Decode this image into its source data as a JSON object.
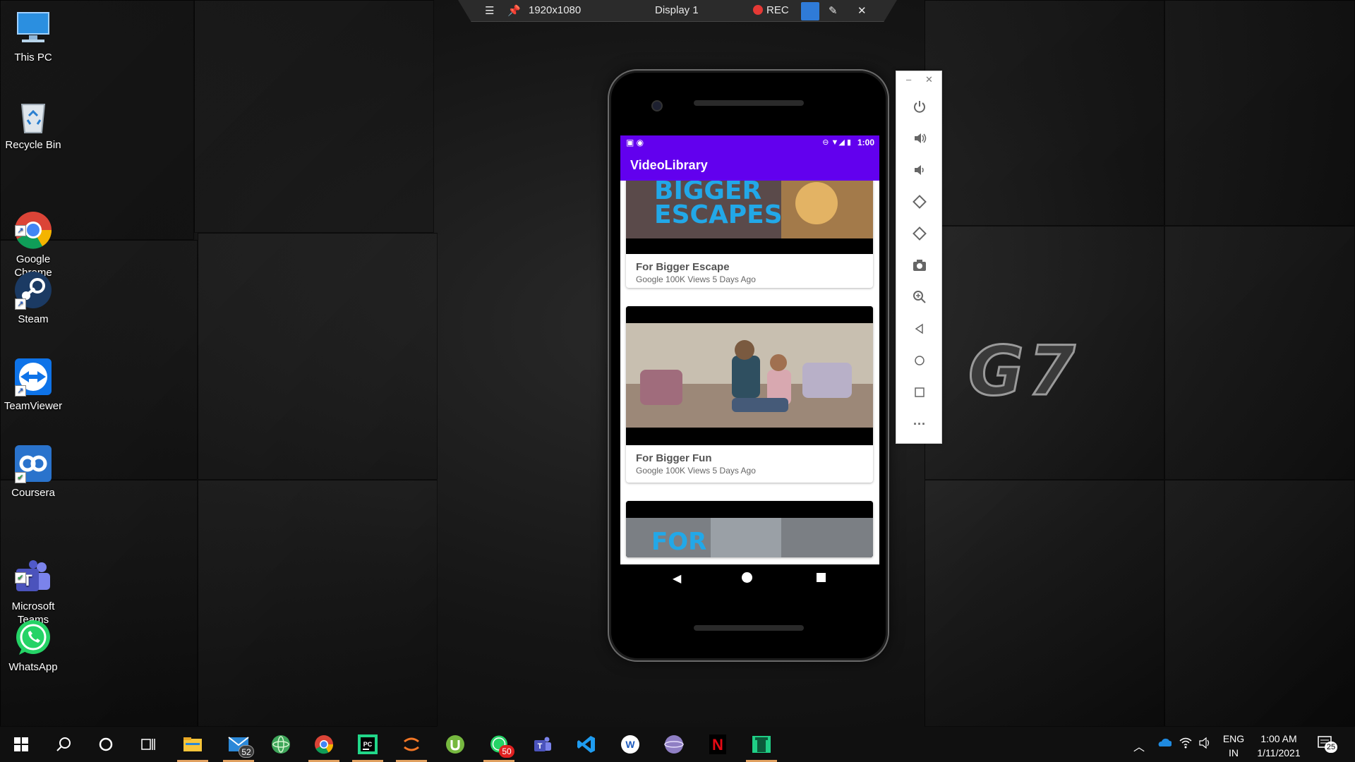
{
  "topbar": {
    "resolution": "1920x1080",
    "display": "Display 1",
    "rec_label": "REC"
  },
  "desktop_icons": [
    {
      "label": "This PC",
      "icon": "monitor-icon"
    },
    {
      "label": "Recycle Bin",
      "icon": "recycle-bin-icon"
    },
    {
      "label": "Google\nChrome",
      "icon": "chrome-icon"
    },
    {
      "label": "Steam",
      "icon": "steam-icon"
    },
    {
      "label": "TeamViewer",
      "icon": "teamviewer-icon"
    },
    {
      "label": "Coursera",
      "icon": "coursera-icon"
    },
    {
      "label": "Microsoft\nTeams",
      "icon": "teams-icon"
    },
    {
      "label": "WhatsApp",
      "icon": "whatsapp-icon"
    }
  ],
  "phone": {
    "status_time": "1:00",
    "app_title": "VideoLibrary",
    "accent": "#6200ee",
    "videos": [
      {
        "thumb_text": "BIGGER\nESCAPES",
        "title": "For Bigger Escape",
        "meta": "Google  100K Views  5 Days Ago"
      },
      {
        "thumb_text": "",
        "title": "For Bigger Fun",
        "meta": "Google  100K Views  5 Days Ago"
      },
      {
        "thumb_text": "FOR",
        "title": "",
        "meta": ""
      }
    ]
  },
  "side_panel": [
    "power-icon",
    "volume-up-icon",
    "volume-down-icon",
    "rotate-left-icon",
    "rotate-right-icon",
    "camera-icon",
    "zoom-icon",
    "back-icon",
    "home-icon",
    "overview-icon",
    "more-icon"
  ],
  "logo_text": "G7",
  "taskbar": {
    "mail_badge": "52",
    "whatsapp_badge": "50",
    "lang": "ENG",
    "region": "IN",
    "time": "1:00 AM",
    "date": "1/11/2021",
    "notif_count": "25"
  }
}
